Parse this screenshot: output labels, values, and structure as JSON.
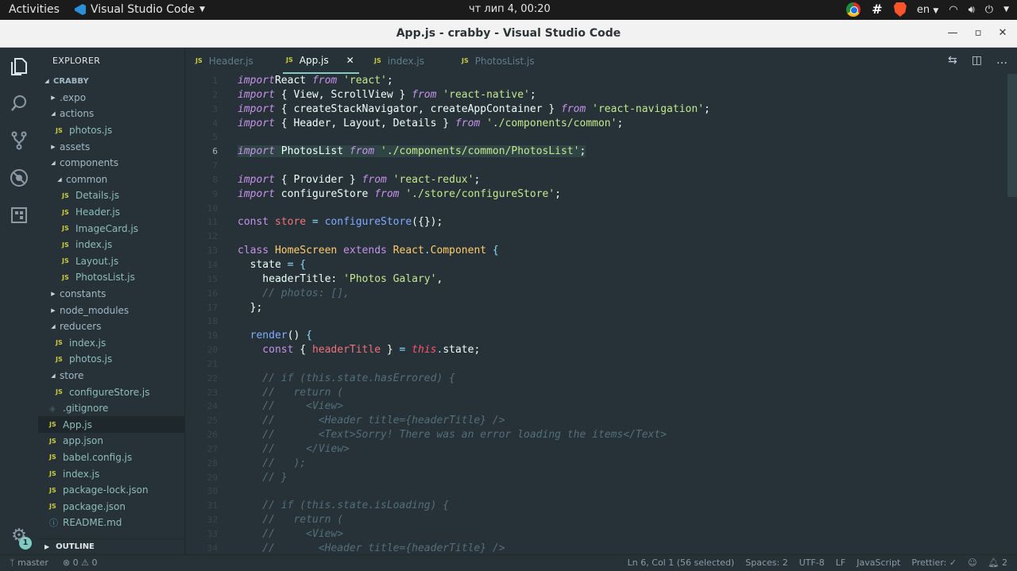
{
  "topbar": {
    "activities": "Activities",
    "app_name": "Visual Studio Code",
    "clock": "чт лип  4, 00:20",
    "lang": "en"
  },
  "window": {
    "title": "App.js - crabby - Visual Studio Code"
  },
  "sidebar": {
    "header": "EXPLORER",
    "outline": "OUTLINE",
    "tree": [
      {
        "label": "CRABBY",
        "kind": "root",
        "depth": 0
      },
      {
        "label": ".expo",
        "kind": "folder-closed",
        "depth": 1
      },
      {
        "label": "actions",
        "kind": "folder-open",
        "depth": 1
      },
      {
        "label": "photos.js",
        "kind": "js",
        "depth": 2
      },
      {
        "label": "assets",
        "kind": "folder-closed",
        "depth": 1
      },
      {
        "label": "components",
        "kind": "folder-open",
        "depth": 1
      },
      {
        "label": "common",
        "kind": "folder-open",
        "depth": 2
      },
      {
        "label": "Details.js",
        "kind": "js",
        "depth": 3
      },
      {
        "label": "Header.js",
        "kind": "js",
        "depth": 3
      },
      {
        "label": "ImageCard.js",
        "kind": "js",
        "depth": 3
      },
      {
        "label": "index.js",
        "kind": "js",
        "depth": 3
      },
      {
        "label": "Layout.js",
        "kind": "js",
        "depth": 3
      },
      {
        "label": "PhotosList.js",
        "kind": "js",
        "depth": 3
      },
      {
        "label": "constants",
        "kind": "folder-closed",
        "depth": 1
      },
      {
        "label": "node_modules",
        "kind": "folder-closed-dim",
        "depth": 1
      },
      {
        "label": "reducers",
        "kind": "folder-open",
        "depth": 1
      },
      {
        "label": "index.js",
        "kind": "js",
        "depth": 2
      },
      {
        "label": "photos.js",
        "kind": "js",
        "depth": 2
      },
      {
        "label": "store",
        "kind": "folder-open",
        "depth": 1
      },
      {
        "label": "configureStore.js",
        "kind": "js",
        "depth": 2
      },
      {
        "label": ".gitignore",
        "kind": "git",
        "depth": 1
      },
      {
        "label": "App.js",
        "kind": "js-selected",
        "depth": 1
      },
      {
        "label": "app.json",
        "kind": "json",
        "depth": 1
      },
      {
        "label": "babel.config.js",
        "kind": "js",
        "depth": 1
      },
      {
        "label": "index.js",
        "kind": "js",
        "depth": 1
      },
      {
        "label": "package-lock.json",
        "kind": "json",
        "depth": 1
      },
      {
        "label": "package.json",
        "kind": "json",
        "depth": 1
      },
      {
        "label": "README.md",
        "kind": "info",
        "depth": 1
      }
    ]
  },
  "tabs": [
    {
      "label": "Header.js",
      "active": false
    },
    {
      "label": "App.js",
      "active": true
    },
    {
      "label": "index.js",
      "active": false
    },
    {
      "label": "PhotosList.js",
      "active": false
    }
  ],
  "editor": {
    "current_line": 6,
    "lines": [
      [
        [
          "kw",
          "import"
        ],
        [
          "",
          "React "
        ],
        [
          "kw",
          "from"
        ],
        [
          "str",
          " 'react'"
        ],
        [
          "",
          ";"
        ]
      ],
      [
        [
          "kw",
          "import"
        ],
        [
          "",
          " { View, ScrollView } "
        ],
        [
          "kw",
          "from"
        ],
        [
          "str",
          " 'react-native'"
        ],
        [
          "",
          ";"
        ]
      ],
      [
        [
          "kw",
          "import"
        ],
        [
          "",
          " { createStackNavigator, createAppContainer } "
        ],
        [
          "kw",
          "from"
        ],
        [
          "str",
          " 'react-navigation'"
        ],
        [
          "",
          ";"
        ]
      ],
      [
        [
          "kw",
          "import"
        ],
        [
          "",
          " { Header, Layout, Details } "
        ],
        [
          "kw",
          "from"
        ],
        [
          "str",
          " './components/common'"
        ],
        [
          "",
          ";"
        ]
      ],
      [],
      [
        [
          "kw",
          "import"
        ],
        [
          "",
          " PhotosList "
        ],
        [
          "kw",
          "from"
        ],
        [
          "str",
          " './components/common/PhotosList'"
        ],
        [
          "",
          ";"
        ]
      ],
      [],
      [
        [
          "kw",
          "import"
        ],
        [
          "",
          " { Provider } "
        ],
        [
          "kw",
          "from"
        ],
        [
          "str",
          " 'react-redux'"
        ],
        [
          "",
          ";"
        ]
      ],
      [
        [
          "kw",
          "import"
        ],
        [
          "",
          " configureStore "
        ],
        [
          "kw",
          "from"
        ],
        [
          "str",
          " './store/configureStore'"
        ],
        [
          "",
          ";"
        ]
      ],
      [],
      [
        [
          "kc",
          "const"
        ],
        [
          "var",
          " store"
        ],
        [
          "op",
          " ="
        ],
        [
          "fn",
          " configureStore"
        ],
        [
          "",
          "({});"
        ]
      ],
      [],
      [
        [
          "kc",
          "class"
        ],
        [
          "cls",
          " HomeScreen"
        ],
        [
          "kc",
          " extends"
        ],
        [
          "cls",
          " React"
        ],
        [
          "op",
          "."
        ],
        [
          "cls",
          "Component"
        ],
        [
          "op",
          " {"
        ]
      ],
      [
        [
          "",
          "  state "
        ],
        [
          "op",
          "="
        ],
        [
          "op",
          " {"
        ]
      ],
      [
        [
          "",
          "    headerTitle: "
        ],
        [
          "str",
          "'Photos Galary'"
        ],
        [
          "",
          ","
        ]
      ],
      [
        [
          "cm",
          "    // photos: [],"
        ]
      ],
      [
        [
          "",
          "  };"
        ]
      ],
      [],
      [
        [
          "fn",
          "  render"
        ],
        [
          "",
          "() "
        ],
        [
          "op",
          "{"
        ]
      ],
      [
        [
          "kc",
          "    const"
        ],
        [
          "",
          " { "
        ],
        [
          "var",
          "headerTitle"
        ],
        [
          "",
          " } "
        ],
        [
          "op",
          "="
        ],
        [
          "this",
          " this"
        ],
        [
          "op",
          "."
        ],
        [
          "",
          "state;"
        ]
      ],
      [],
      [
        [
          "cm",
          "    // if (this.state.hasErrored) {"
        ]
      ],
      [
        [
          "cm",
          "    //   return ("
        ]
      ],
      [
        [
          "cm",
          "    //     <View>"
        ]
      ],
      [
        [
          "cm",
          "    //       <Header title={headerTitle} />"
        ]
      ],
      [
        [
          "cm",
          "    //       <Text>Sorry! There was an error loading the items</Text>"
        ]
      ],
      [
        [
          "cm",
          "    //     </View>"
        ]
      ],
      [
        [
          "cm",
          "    //   );"
        ]
      ],
      [
        [
          "cm",
          "    // }"
        ]
      ],
      [],
      [
        [
          "cm",
          "    // if (this.state.isLoading) {"
        ]
      ],
      [
        [
          "cm",
          "    //   return ("
        ]
      ],
      [
        [
          "cm",
          "    //     <View>"
        ]
      ],
      [
        [
          "cm",
          "    //       <Header title={headerTitle} />"
        ]
      ]
    ]
  },
  "statusbar": {
    "branch": "master",
    "problems": "⊗ 0 ⚠ 0",
    "position": "Ln 6, Col 1 (56 selected)",
    "spaces": "Spaces: 2",
    "encoding": "UTF-8",
    "eol": "LF",
    "language": "JavaScript",
    "prettier": "Prettier: ✓",
    "notifications": "2"
  },
  "activity": {
    "settings_badge": "1"
  }
}
